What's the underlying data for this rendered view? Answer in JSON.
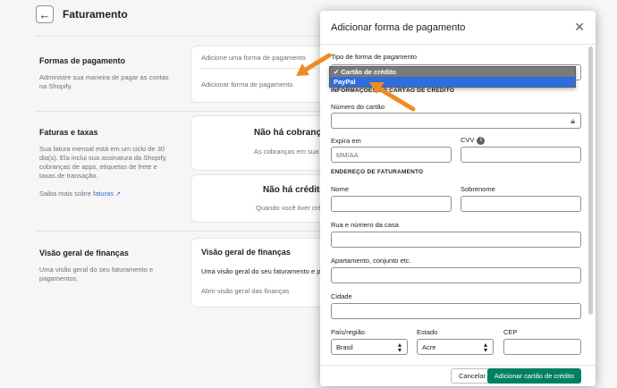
{
  "page": {
    "title": "Faturamento",
    "payment_methods": {
      "title": "Formas de pagamento",
      "description": "Administre sua maneira de pagar as contas na Shopify.",
      "card_text": "Adicione uma forma de pagamento",
      "add_link": "Adicionar forma de pagamento"
    },
    "invoices": {
      "title": "Faturas e taxas",
      "description": "Sua fatura mensal está em um ciclo de 30 dia(s). Ela inclui sua assinatura da Shopify, cobranças de apps, etiquetas de frete e taxas de transação.",
      "learn_prefix": "Saiba mais sobre",
      "learn_link": "faturas",
      "no_charges_title": "Não há cobranças",
      "no_charges_text": "As cobranças em sua fatura",
      "no_credits_title": "Não há créditos",
      "no_credits_text": "Quando você tiver créditos"
    },
    "finance": {
      "title": "Visão geral de finanças",
      "description": "Uma visão geral do seu faturamento e pagamentos.",
      "card_title": "Visão geral de finanças",
      "card_text": "Uma visão geral do seu faturamento e p",
      "link": "Abrir visão geral das finanças"
    }
  },
  "modal": {
    "title": "Adicionar forma de pagamento",
    "payment_type_label": "Tipo de forma de pagamento",
    "dropdown_options": [
      "✓ Cartão de crédito",
      "PayPal"
    ],
    "card_info_heading": "INFORMAÇÕES DO CARTÃO DE CRÉDITO",
    "card_number_label": "Número do cartão",
    "expiry_label": "Expira em",
    "expiry_placeholder": "MM/AA",
    "cvv_label": "CVV",
    "billing_heading": "ENDEREÇO DE FATURAMENTO",
    "first_name_label": "Nome",
    "last_name_label": "Sobrenome",
    "street_label": "Rua e número da casa",
    "apartment_label": "Apartamento, conjunto etc.",
    "city_label": "Cidade",
    "country_label": "País/região",
    "country_value": "Brasil",
    "state_label": "Estado",
    "state_value": "Acre",
    "zip_label": "CEP",
    "cancel_button": "Cancelar",
    "submit_button": "Adicionar cartão de crédito"
  },
  "colors": {
    "accent_arrow": "#f08a24",
    "primary_button": "#008060",
    "link": "#2c6ecb",
    "selected_option": "#2d6de2"
  }
}
